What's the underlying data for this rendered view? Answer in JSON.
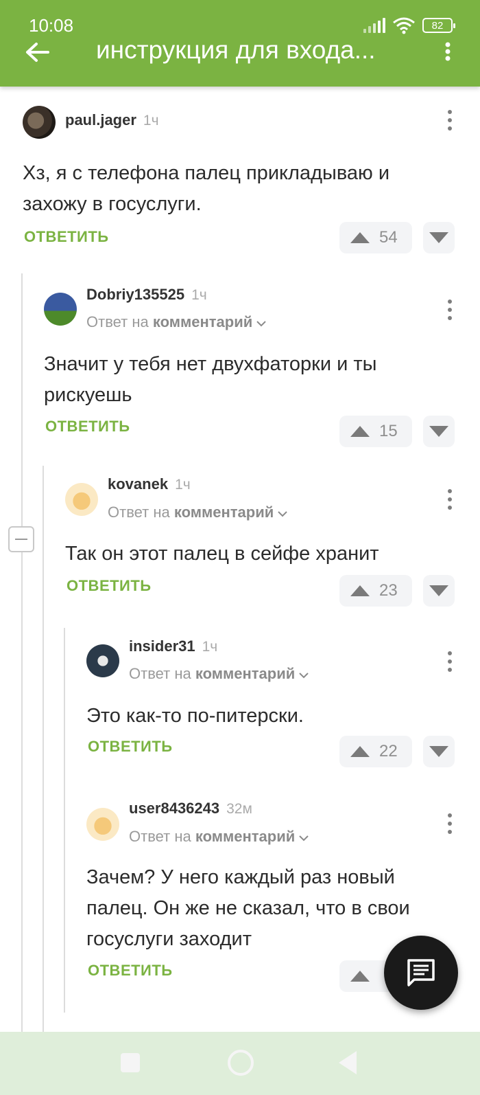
{
  "status_bar": {
    "time": "10:08",
    "battery": "82"
  },
  "header": {
    "title": "инструкция для входа..."
  },
  "comments": [
    {
      "author": "paul.jager",
      "time": "1ч",
      "reply_prefix": "",
      "reply_target": "",
      "text": "Хз, я с телефона палец прикладываю и захожу в госуслуги.",
      "reply_label": "ОТВЕТИТЬ",
      "votes": "54"
    },
    {
      "author": "Dobriy135525",
      "time": "1ч",
      "reply_prefix": "Ответ на",
      "reply_target": "комментарий",
      "text": "Значит у тебя нет двухфаторки и ты рискуешь",
      "reply_label": "ОТВЕТИТЬ",
      "votes": "15"
    },
    {
      "author": "kovanek",
      "time": "1ч",
      "reply_prefix": "Ответ на",
      "reply_target": "комментарий",
      "text": "Так он этот палец в сейфе хранит",
      "reply_label": "ОТВЕТИТЬ",
      "votes": "23"
    },
    {
      "author": "insider31",
      "time": "1ч",
      "reply_prefix": "Ответ на",
      "reply_target": "комментарий",
      "text": "Это как-то по-питерски.",
      "reply_label": "ОТВЕТИТЬ",
      "votes": "22"
    },
    {
      "author": "user8436243",
      "time": "32м",
      "reply_prefix": "Ответ на",
      "reply_target": "комментарий",
      "text": "Зачем? У него каждый раз новый палец. Он же не сказал, что в свои госуслуги заходит",
      "reply_label": "ОТВЕТИТЬ",
      "votes": ""
    }
  ],
  "colors": {
    "brand": "#7bb342",
    "fab": "#1a1a1a",
    "navbar": "#dfeeda"
  },
  "icons": {
    "back": "arrow-left-icon",
    "menu": "more-vertical-icon",
    "upvote": "triangle-up-icon",
    "downvote": "triangle-down-icon",
    "fab": "comment-icon"
  }
}
